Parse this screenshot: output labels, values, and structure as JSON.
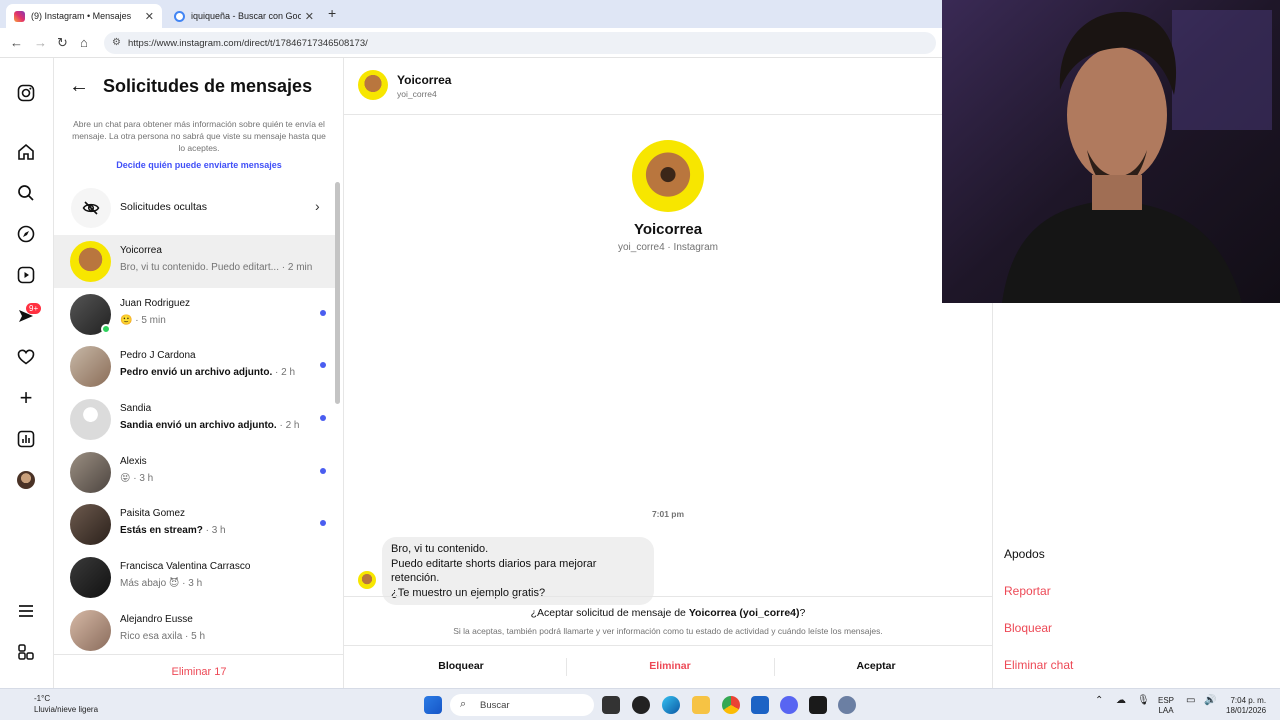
{
  "browser": {
    "tabs": [
      {
        "title": "(9) Instagram • Mensajes",
        "active": true
      },
      {
        "title": "iquiqueña - Buscar con Google",
        "active": false
      }
    ],
    "url": "https://www.instagram.com/direct/t/17846717346508173/"
  },
  "rail": {
    "badge": "9+",
    "icons": [
      "instagram-logo-icon",
      "home-icon",
      "search-icon",
      "explore-icon",
      "reels-icon",
      "messages-icon",
      "notifications-icon",
      "create-icon",
      "dashboard-icon",
      "profile-avatar",
      "menu-icon",
      "threads-icon"
    ]
  },
  "requests": {
    "title": "Solicitudes de mensajes",
    "info": "Abre un chat para obtener más información sobre quién te envía el mensaje. La otra persona no sabrá que viste su mensaje hasta que lo aceptes.",
    "link": "Decide quién puede enviarte mensajes",
    "hidden_label": "Solicitudes ocultas",
    "items": [
      {
        "name": "Yoicorrea",
        "msg": "Bro, vi tu contenido. Puedo editart...",
        "time": "· 2 min",
        "bold": false,
        "unread": false,
        "selected": true
      },
      {
        "name": "Juan Rodriguez",
        "msg": "🙂",
        "time": "· 5 min",
        "bold": false,
        "unread": true,
        "selected": false
      },
      {
        "name": "Pedro J Cardona",
        "msg": "Pedro envió un archivo adjunto.",
        "time": "· 2 h",
        "bold": true,
        "unread": true,
        "selected": false
      },
      {
        "name": "Sandia",
        "msg": "Sandia envió un archivo adjunto.",
        "time": "· 2 h",
        "bold": true,
        "unread": true,
        "selected": false
      },
      {
        "name": "Alexis",
        "msg": "😝",
        "time": "· 3 h",
        "bold": false,
        "unread": true,
        "selected": false
      },
      {
        "name": "Paisita Gomez",
        "msg": "Estás en stream?",
        "time": "· 3 h",
        "bold": true,
        "unread": true,
        "selected": false
      },
      {
        "name": "Francisca Valentina Carrasco",
        "msg": "Más abajo 😈",
        "time": "· 3 h",
        "bold": false,
        "unread": false,
        "selected": false
      },
      {
        "name": "Alejandro Eusse",
        "msg": "Rico esa axila",
        "time": "· 5 h",
        "bold": false,
        "unread": false,
        "selected": false
      }
    ],
    "delete_all": "Eliminar 17"
  },
  "chat": {
    "name": "Yoicorrea",
    "username": "yoi_corre4",
    "profile_sub": "yoi_corre4 · Instagram",
    "timestamp": "7:01 pm",
    "message_lines": [
      "Bro, vi tu contenido.",
      "Puedo editarte shorts diarios para mejorar retención.",
      "¿Te muestro un ejemplo gratis?"
    ],
    "accept_prefix": "¿Aceptar solicitud de mensaje de ",
    "accept_name": "Yoicorrea (yoi_corre4)",
    "accept_suffix": "?",
    "accept_note": "Si la aceptas, también podrá llamarte y ver información como tu estado de actividad y cuándo leíste los mensajes.",
    "btn_block": "Bloquear",
    "btn_delete": "Eliminar",
    "btn_accept": "Aceptar"
  },
  "details": {
    "nicknames": "Apodos",
    "report": "Reportar",
    "block": "Bloquear",
    "delete_chat": "Eliminar chat"
  },
  "taskbar": {
    "temp": "-1°C",
    "weather": "Lluvia/nieve ligera",
    "search": "Buscar",
    "lang1": "ESP",
    "lang2": "LAA",
    "time": "7:04 p. m.",
    "date": "18/01/2026"
  },
  "colors": {
    "link": "#4150f7",
    "danger": "#ed4956",
    "unread_dot": "#4a5df0"
  }
}
